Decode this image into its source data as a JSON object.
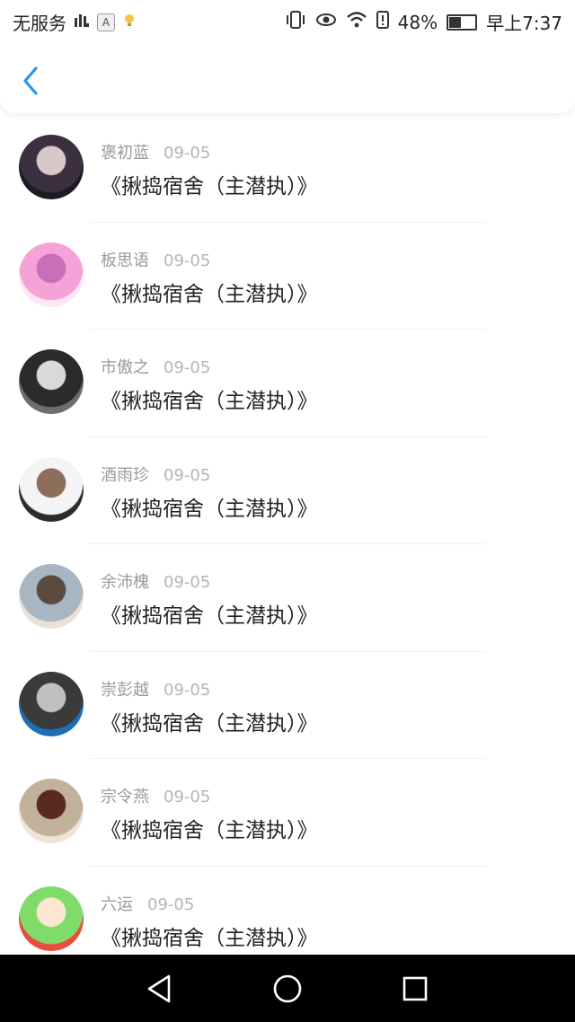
{
  "status_bar": {
    "carrier": "无服务",
    "battery_percent": "48%",
    "battery_level": 0.48,
    "time": "早上7:37",
    "icons": [
      "signal-bars-icon",
      "a-letter-icon",
      "notification-icon",
      "vibrate-icon",
      "eye-icon",
      "wifi-icon",
      "alert-icon",
      "battery-icon"
    ]
  },
  "header": {
    "back_icon": "chevron-left-icon",
    "accent_color": "#2196f3"
  },
  "items": [
    {
      "name": "褒初蓝",
      "date": "09-05",
      "title": "《揪捣宿舍（主潜执）》",
      "avatar_colors": [
        "#3a3040",
        "#d9c8c8",
        "#1e1a22"
      ]
    },
    {
      "name": "板思语",
      "date": "09-05",
      "title": "《揪捣宿舍（主潜执）》",
      "avatar_colors": [
        "#f5a3d6",
        "#c86fb8",
        "#fde7f3"
      ]
    },
    {
      "name": "市傲之",
      "date": "09-05",
      "title": "《揪捣宿舍（主潜执）》",
      "avatar_colors": [
        "#2b2b2b",
        "#d9d9d9",
        "#6d6d6d"
      ]
    },
    {
      "name": "酒雨珍",
      "date": "09-05",
      "title": "《揪捣宿舍（主潜执）》",
      "avatar_colors": [
        "#f4f4f4",
        "#8c6e5a",
        "#2c2c2c"
      ]
    },
    {
      "name": "余沛槐",
      "date": "09-05",
      "title": "《揪捣宿舍（主潜执）》",
      "avatar_colors": [
        "#a7b6c2",
        "#5b4a3f",
        "#e9e1d6"
      ]
    },
    {
      "name": "崇彭越",
      "date": "09-05",
      "title": "《揪捣宿舍（主潜执）》",
      "avatar_colors": [
        "#3a3a3a",
        "#c0c0c0",
        "#1f6fb8"
      ]
    },
    {
      "name": "宗令燕",
      "date": "09-05",
      "title": "《揪捣宿舍（主潜执）》",
      "avatar_colors": [
        "#c3b29b",
        "#5a2a22",
        "#efe4d6"
      ]
    },
    {
      "name": "六运",
      "date": "09-05",
      "title": "《揪捣宿舍（主潜执）》",
      "avatar_colors": [
        "#7fdc6b",
        "#fce6d2",
        "#e74c3c"
      ]
    }
  ],
  "nav_bar": {
    "back_icon": "triangle-back-icon",
    "home_icon": "circle-home-icon",
    "recents_icon": "square-recents-icon"
  }
}
